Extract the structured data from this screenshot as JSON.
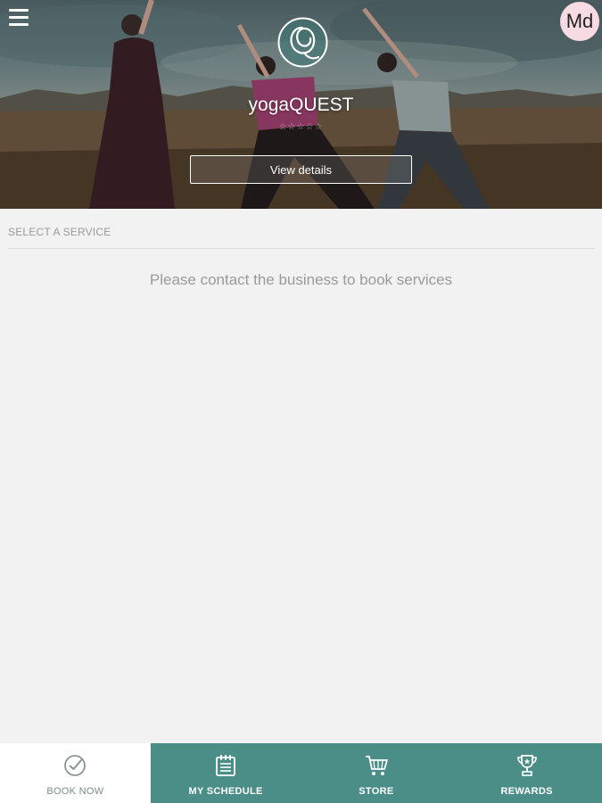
{
  "header": {
    "brand_name": "yogaQUEST",
    "rating_stars": "☆☆☆☆☆",
    "view_details_label": "View details",
    "avatar_initials": "Md",
    "avatar_color": "#f6dbe2",
    "logo_letter": "Q"
  },
  "main": {
    "section_title": "SELECT A SERVICE",
    "empty_message": "Please contact the business to book services"
  },
  "tabs": [
    {
      "label": "BOOK NOW",
      "icon": "check-circle-icon",
      "active": true
    },
    {
      "label": "MY SCHEDULE",
      "icon": "calendar-icon",
      "active": false
    },
    {
      "label": "STORE",
      "icon": "cart-icon",
      "active": false
    },
    {
      "label": "REWARDS",
      "icon": "trophy-icon",
      "active": false
    }
  ],
  "colors": {
    "accent": "#4a8e87",
    "background": "#f2f2f2"
  }
}
